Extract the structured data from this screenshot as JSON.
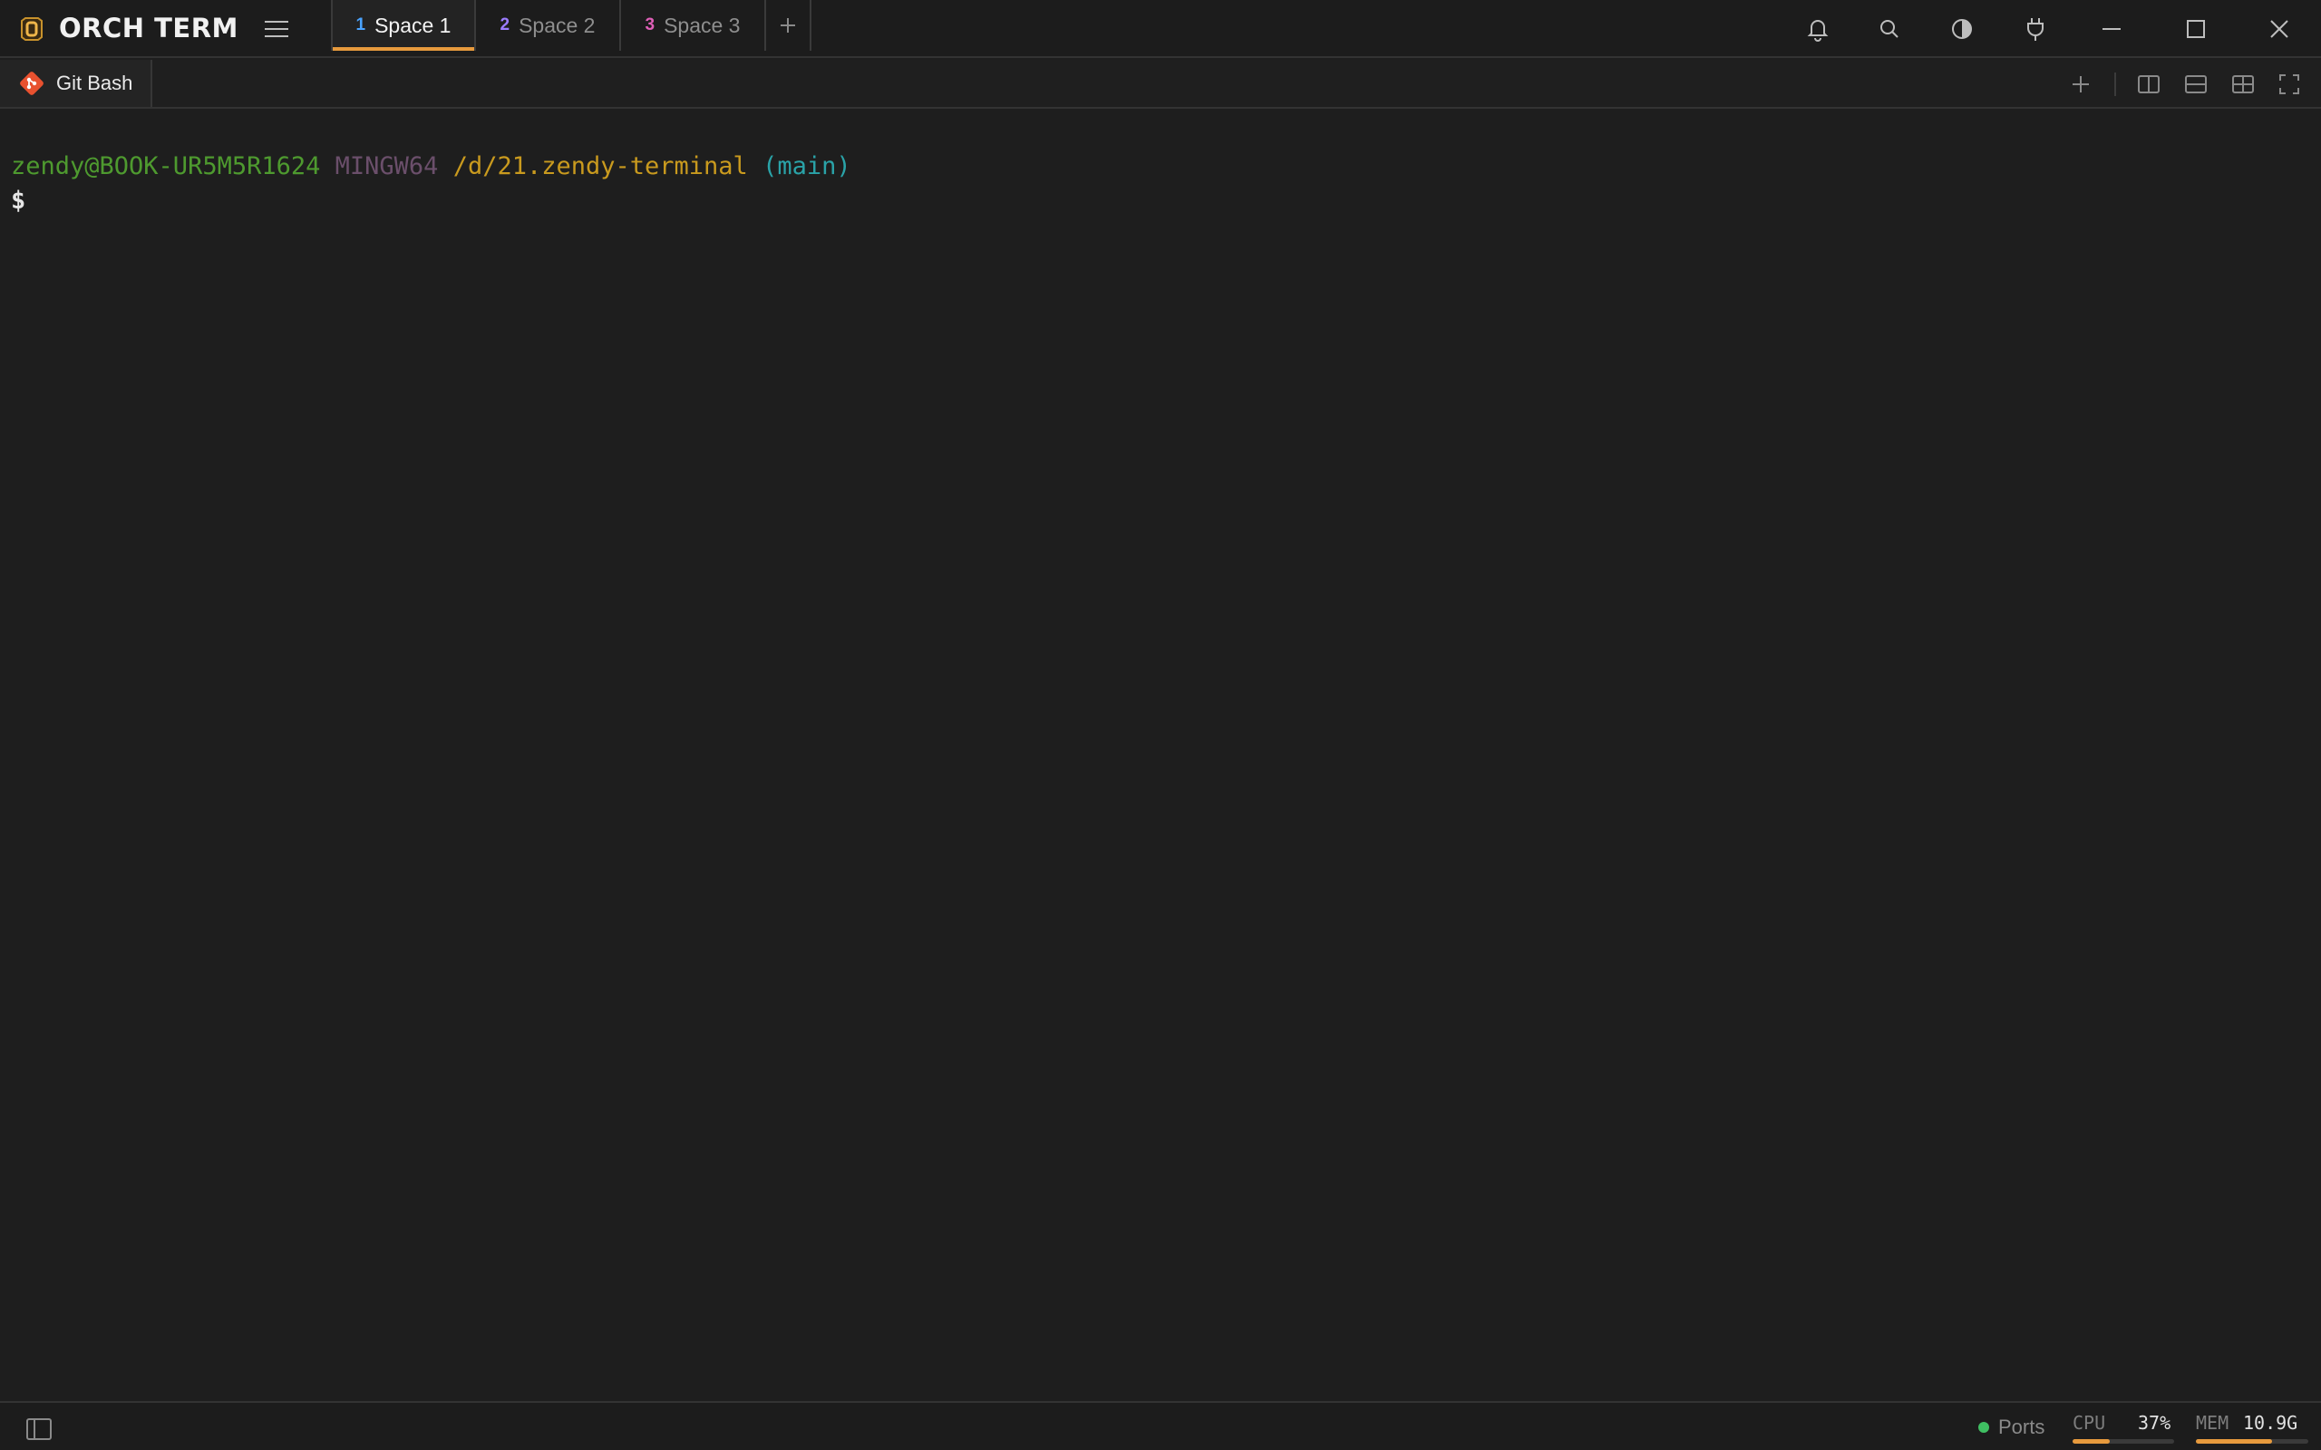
{
  "app": {
    "title": "ORCH TERM",
    "logo_letter": "O"
  },
  "spaces": [
    {
      "num": "1",
      "label": "Space 1",
      "color": "#4aa3ff",
      "active": true
    },
    {
      "num": "2",
      "label": "Space 2",
      "color": "#9b7cff",
      "active": false
    },
    {
      "num": "3",
      "label": "Space 3",
      "color": "#e05fb8",
      "active": false
    }
  ],
  "add_space_label": "+",
  "titlebar_icons": [
    "bell-icon",
    "search-icon",
    "contrast-icon",
    "plug-icon",
    "minimize-icon",
    "maximize-icon",
    "close-icon"
  ],
  "pane": {
    "tab_label": "Git Bash",
    "icons": [
      "plus-icon",
      "split-vertical-icon",
      "split-horizontal-icon",
      "grid-icon",
      "fullscreen-icon"
    ]
  },
  "terminal": {
    "user_host": "zendy@BOOK-UR5M5R1624",
    "system": "MINGW64",
    "path": "/d/21.zendy-terminal",
    "branch": "(main)",
    "prompt": "$"
  },
  "status": {
    "ports_label": "Ports",
    "cpu_label": "CPU",
    "cpu_value": "37%",
    "cpu_fraction": 0.37,
    "mem_label": "MEM",
    "mem_value": "10.9G",
    "mem_fraction": 0.68
  },
  "colors": {
    "accent": "#e79a3d",
    "ports_ok": "#3fbf62"
  }
}
